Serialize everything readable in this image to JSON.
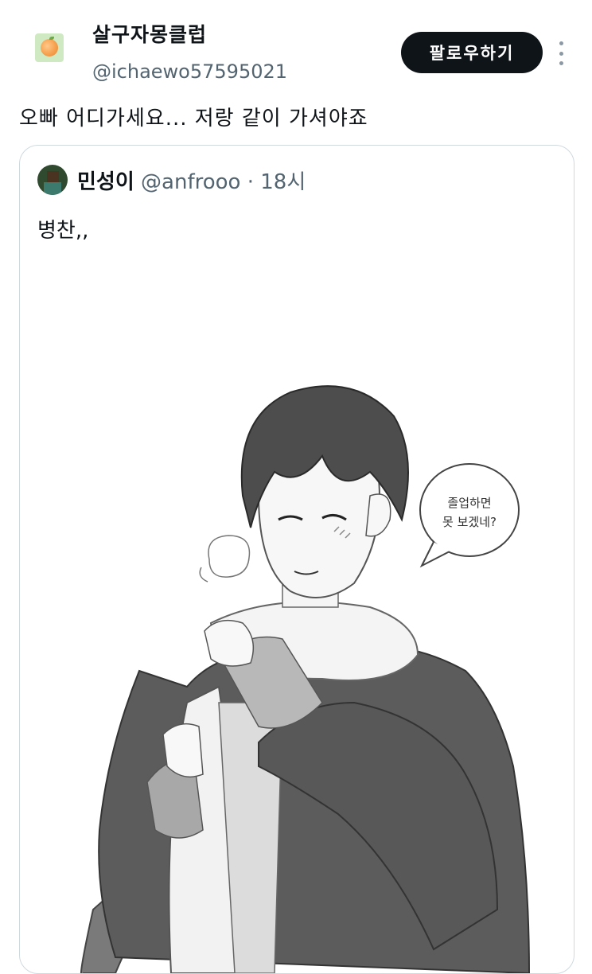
{
  "author": {
    "display_name": "살구자몽클럽",
    "handle": "@ichaewo57595021",
    "avatar_icon": "peach-icon"
  },
  "follow_label": "팔로우하기",
  "tweet_text": "오빠 어디가세요... 저랑 같이 가셔야죠",
  "quoted": {
    "display_name": "민성이",
    "handle": "@anfrooo",
    "separator": "·",
    "time": "18시",
    "text": "병찬,,",
    "speech_bubble": {
      "line1": "졸업하면",
      "line2": "못 보겠네?"
    }
  },
  "colors": {
    "text": "#0f1419",
    "muted": "#536471",
    "button_bg": "#0f1419",
    "border": "#cfd9de"
  }
}
